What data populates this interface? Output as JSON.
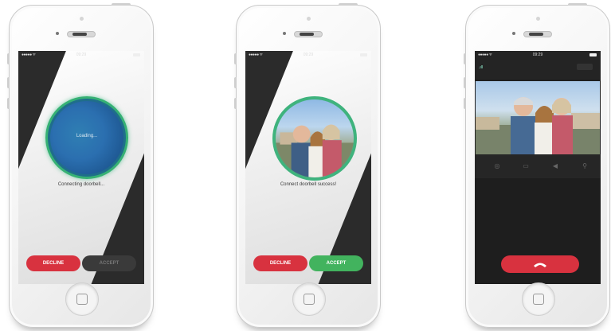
{
  "phones": [
    {
      "status": {
        "signal": "●●●●● ᯤ",
        "time": "09:29"
      },
      "loading_text": "Loading...",
      "status_text": "Connecting doorbell...",
      "decline_label": "DECLINE",
      "accept_label": "ACCEPT"
    },
    {
      "status": {
        "signal": "●●●●● ᯤ",
        "time": "09:29"
      },
      "status_text": "Connect doorbell success!",
      "decline_label": "DECLINE",
      "accept_label": "ACCEPT"
    },
    {
      "status": {
        "signal": "●●●●● ᯤ",
        "time": "09:29"
      },
      "signal_strength": ".ıll",
      "controls": [
        {
          "icon": "camera-icon",
          "glyph": "◎"
        },
        {
          "icon": "video-icon",
          "glyph": "▭"
        },
        {
          "icon": "speaker-icon",
          "glyph": "◀"
        },
        {
          "icon": "microphone-icon",
          "glyph": "⚲"
        }
      ]
    }
  ],
  "colors": {
    "decline": "#d8323f",
    "accept": "#42b35e",
    "screen_bg": "#2b2b2b",
    "ring": "#3fb37d"
  }
}
